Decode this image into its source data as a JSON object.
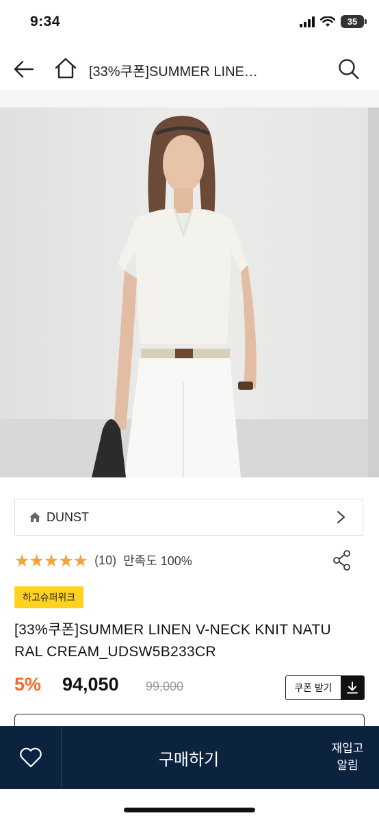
{
  "status_bar": {
    "time": "9:34",
    "battery": "35"
  },
  "nav": {
    "title": "[33%쿠폰]SUMMER LINE…"
  },
  "brand": {
    "name": "DUNST"
  },
  "rating": {
    "stars_text": "★★★★★",
    "score": 5,
    "review_count": "(10)",
    "satisfaction": "만족도 100%"
  },
  "promo_badge": "하고슈퍼위크",
  "product": {
    "title": "[33%쿠폰]SUMMER LINEN V-NECK KNIT NATURAL CREAM_UDSW5B233CR",
    "discount": "5%",
    "sale_price": "94,050",
    "original_price": "99,000"
  },
  "coupon": {
    "label": "쿠폰 받기"
  },
  "bottom_bar": {
    "buy_label": "구매하기",
    "restock_line1": "재입고",
    "restock_line2": "알림"
  },
  "colors": {
    "accent_orange": "#f26b2e",
    "star": "#f2a33a",
    "badge_yellow": "#ffd21f",
    "bottom_navy": "#0c2340"
  },
  "icons": [
    "back-arrow-icon",
    "home-icon",
    "search-icon",
    "chevron-right-icon",
    "share-icon",
    "download-icon",
    "heart-icon"
  ]
}
